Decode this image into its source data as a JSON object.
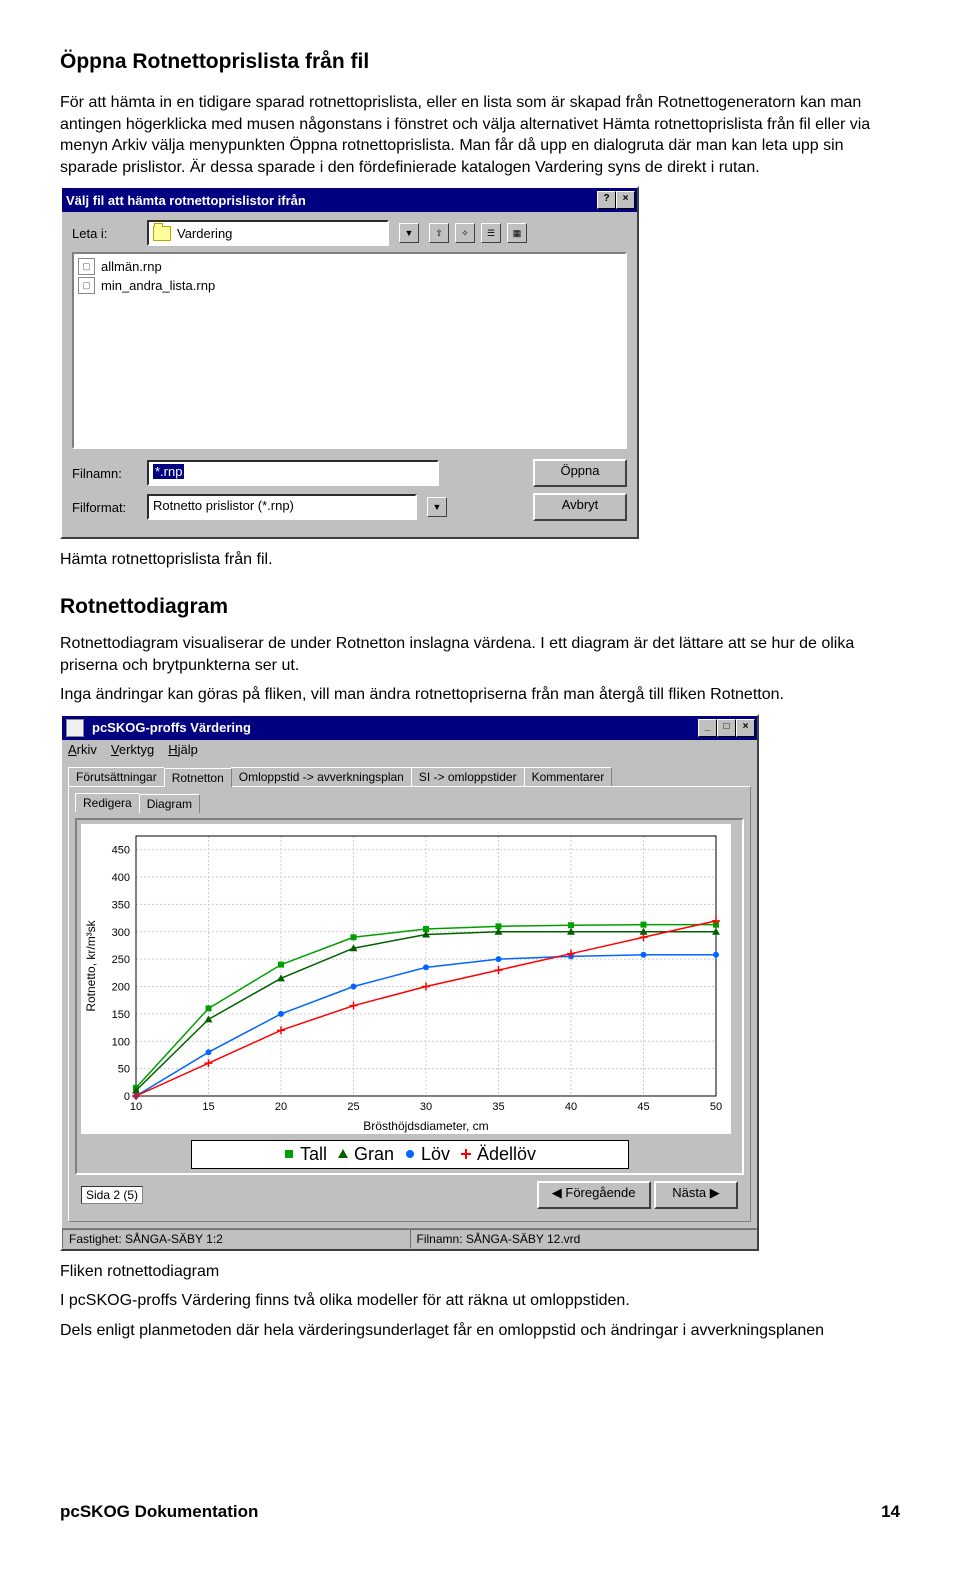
{
  "heading1": "Öppna Rotnettoprislista från fil",
  "para1": "För att hämta in en tidigare sparad rotnettoprislista, eller en lista som är skapad från Rotnettogeneratorn kan man antingen högerklicka med musen någonstans i fönstret och välja alternativet Hämta rotnettoprislista från fil eller via menyn Arkiv välja menypunkten Öppna rotnettoprislista. Man får då upp en dialogruta där man kan leta upp sin sparade prislistor. Är dessa sparade i den fördefinierade katalogen Vardering syns de direkt i rutan.",
  "dialog": {
    "title": "Välj fil att hämta rotnettoprislistor ifrån",
    "label_look_in": "Leta i:",
    "folder": "Vardering",
    "files": [
      "allmän.rnp",
      "min_andra_lista.rnp"
    ],
    "label_filename": "Filnamn:",
    "filename_value": "*.rnp",
    "label_filetype": "Filformat:",
    "filetype_value": "Rotnetto prislistor (*.rnp)",
    "btn_open": "Öppna",
    "btn_cancel": "Avbryt"
  },
  "caption_dialog": "Hämta rotnettoprislista från fil.",
  "heading2": "Rotnettodiagram",
  "para2": "Rotnettodiagram visualiserar de under Rotnetton inslagna värdena. I ett diagram är det lättare att se hur de olika priserna och brytpunkterna ser ut.",
  "para3": "Inga ändringar kan göras på fliken, vill man ändra rotnettopriserna från man återgå till fliken Rotnetton.",
  "app": {
    "title": "pcSKOG-proffs Värdering",
    "menus": [
      "Arkiv",
      "Verktyg",
      "Hjälp"
    ],
    "tabs": [
      "Förutsättningar",
      "Rotnetton",
      "Omloppstid -> avverkningsplan",
      "SI -> omloppstider",
      "Kommentarer"
    ],
    "subtabs": [
      "Redigera",
      "Diagram"
    ],
    "legend": [
      "Tall",
      "Gran",
      "Löv",
      "Ädellöv"
    ],
    "sida": "Sida 2 (5)",
    "prev": "Föregående",
    "next": "Nästa",
    "status_left": "Fastighet: SÅNGA-SÄBY 1:2",
    "status_right": "Filnamn: SÅNGA-SÄBY 12.vrd"
  },
  "chart_data": {
    "type": "line",
    "xlabel": "Brösthöjdsdiameter, cm",
    "ylabel": "Rotnetto, kr/m³sk",
    "xlim": [
      10,
      50
    ],
    "ylim": [
      0,
      475
    ],
    "xticks": [
      10,
      15,
      20,
      25,
      30,
      35,
      40,
      45,
      50
    ],
    "yticks": [
      0,
      50,
      100,
      150,
      200,
      250,
      300,
      350,
      400,
      450
    ],
    "series": [
      {
        "name": "Tall",
        "color": "#00a000",
        "marker": "square",
        "x": [
          10,
          15,
          20,
          25,
          30,
          35,
          40,
          45,
          50
        ],
        "y": [
          15,
          160,
          240,
          290,
          305,
          310,
          312,
          313,
          313
        ]
      },
      {
        "name": "Gran",
        "color": "#006000",
        "marker": "triangle",
        "x": [
          10,
          15,
          20,
          25,
          30,
          35,
          40,
          45,
          50
        ],
        "y": [
          10,
          140,
          215,
          270,
          295,
          300,
          300,
          300,
          300
        ]
      },
      {
        "name": "Löv",
        "color": "#0066ff",
        "marker": "circle",
        "x": [
          10,
          15,
          20,
          25,
          30,
          35,
          40,
          45,
          50
        ],
        "y": [
          0,
          80,
          150,
          200,
          235,
          250,
          255,
          258,
          258
        ]
      },
      {
        "name": "Ädellöv",
        "color": "#ff0000",
        "marker": "plus",
        "x": [
          10,
          15,
          20,
          25,
          30,
          35,
          40,
          45,
          50
        ],
        "y": [
          0,
          60,
          120,
          165,
          200,
          230,
          260,
          290,
          320
        ]
      }
    ]
  },
  "caption_app": "Fliken rotnettodiagram",
  "para4": "I pcSKOG-proffs Värdering finns två olika modeller för att räkna ut omloppstiden.",
  "para5": "Dels enligt planmetoden där hela värderingsunderlaget får en omloppstid och ändringar i avverkningsplanen",
  "footer_left": "pcSKOG Dokumentation",
  "footer_right": "14"
}
